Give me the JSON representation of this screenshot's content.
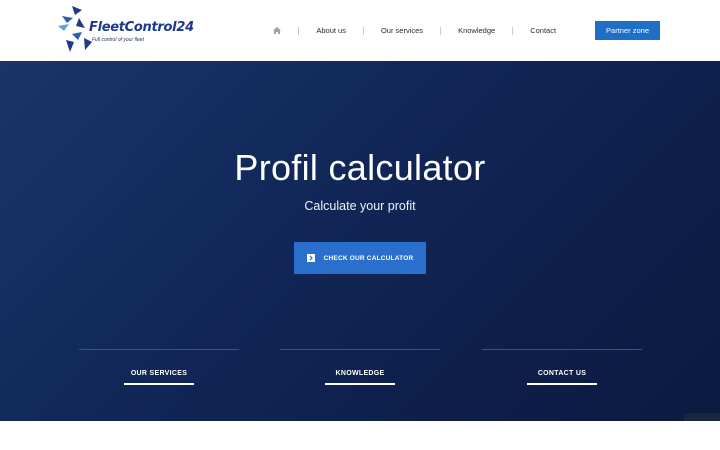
{
  "header": {
    "logo": {
      "name": "FleetControl24",
      "tagline": "Full control of your fleet"
    },
    "nav": {
      "home_icon": "home-icon",
      "items": [
        {
          "label": "About us"
        },
        {
          "label": "Our services"
        },
        {
          "label": "Knowledge"
        },
        {
          "label": "Contact"
        }
      ],
      "partner_label": "Partner zone"
    }
  },
  "hero": {
    "title": "Profil calculator",
    "subtitle": "Calculate your profit",
    "cta": {
      "label": "CHECK OUR CALCULATOR",
      "icon": "chevron-right-icon"
    },
    "columns": [
      {
        "title": "OUR SERVICES"
      },
      {
        "title": "KNOWLEDGE"
      },
      {
        "title": "CONTACT US"
      }
    ]
  },
  "colors": {
    "brand_blue": "#1f6fc8",
    "cta_blue": "#2a6fcc",
    "hero_dark": "#0e1f4b",
    "logo_navy": "#1e3a8a"
  }
}
